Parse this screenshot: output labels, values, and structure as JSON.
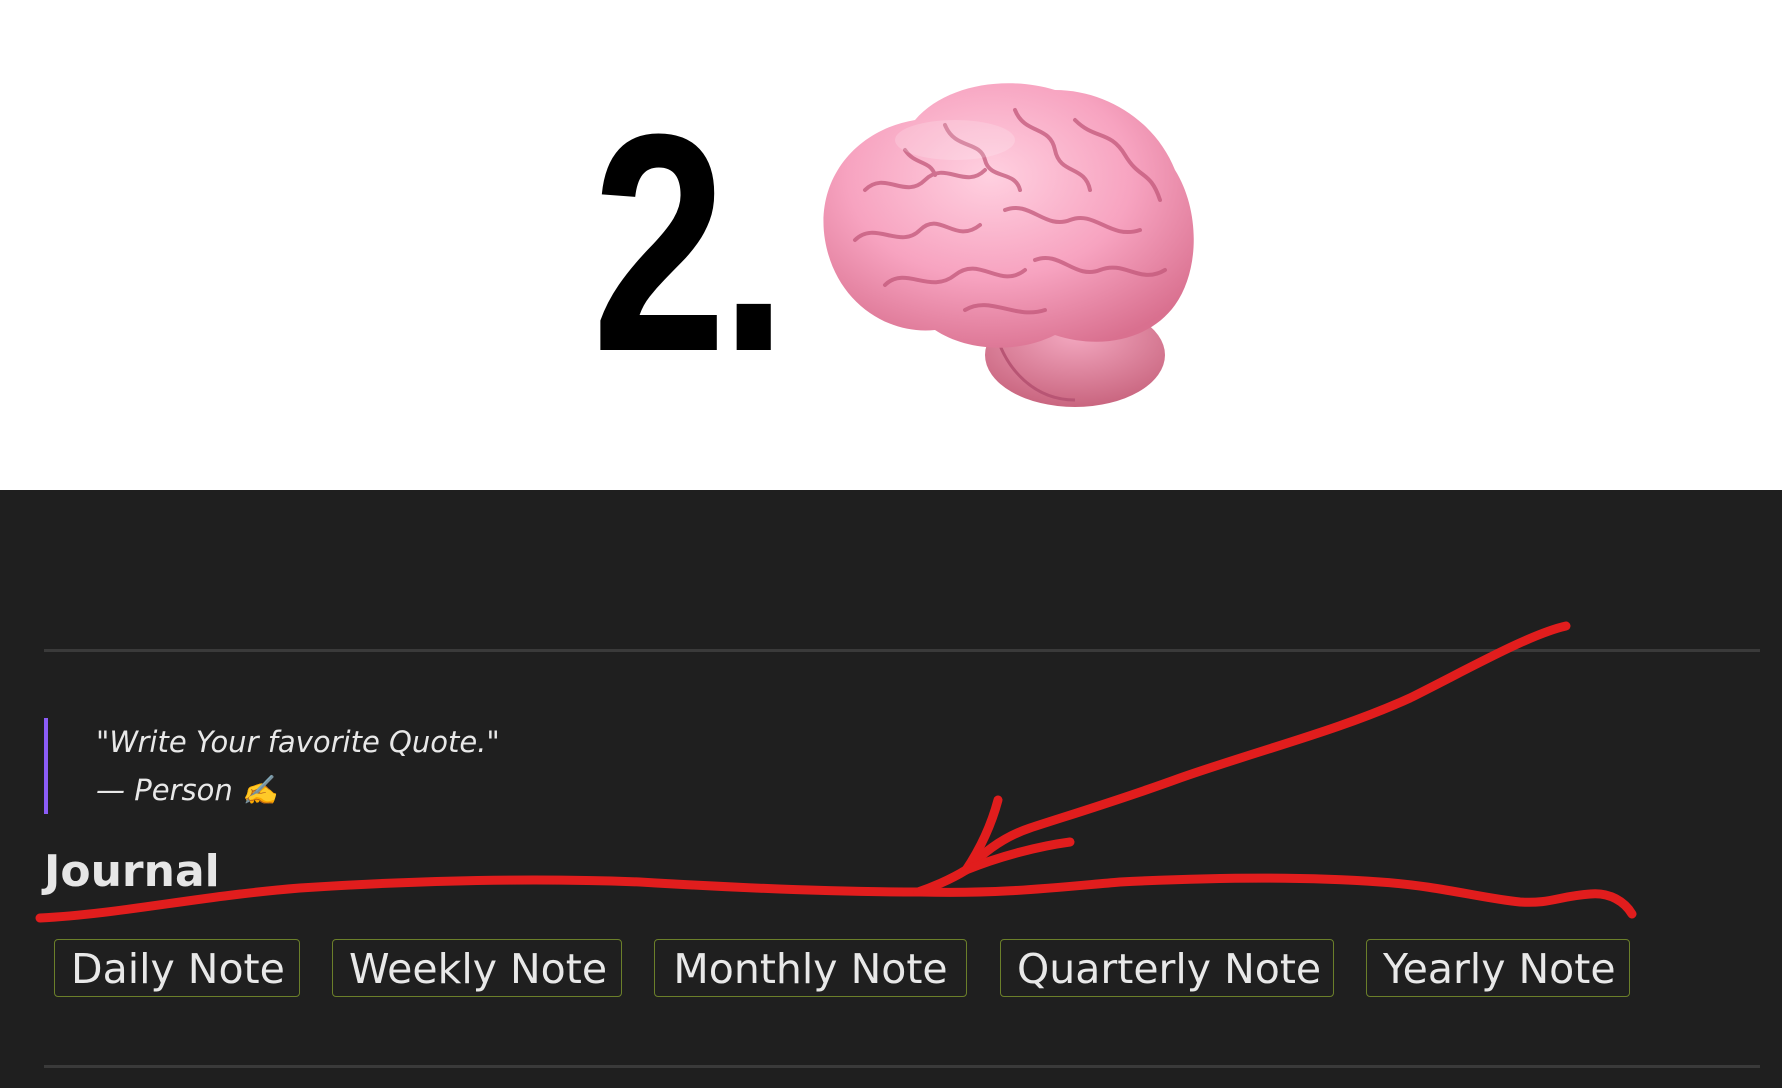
{
  "banner": {
    "text": "2.",
    "icon": "brain-icon"
  },
  "quote": {
    "line1": "\"Write Your favorite Quote.\"",
    "line2": "— Person ✍️"
  },
  "journal": {
    "heading": "Journal",
    "buttons": [
      {
        "label": "Daily Note"
      },
      {
        "label": "Weekly Note"
      },
      {
        "label": "Monthly Note"
      },
      {
        "label": "Quarterly Note"
      },
      {
        "label": "Yearly Note"
      }
    ]
  },
  "colors": {
    "quote_border": "#8b5cf6",
    "button_border": "#6b7f2a",
    "annotation": "#e11d1d",
    "background": "#1f1f1f"
  }
}
